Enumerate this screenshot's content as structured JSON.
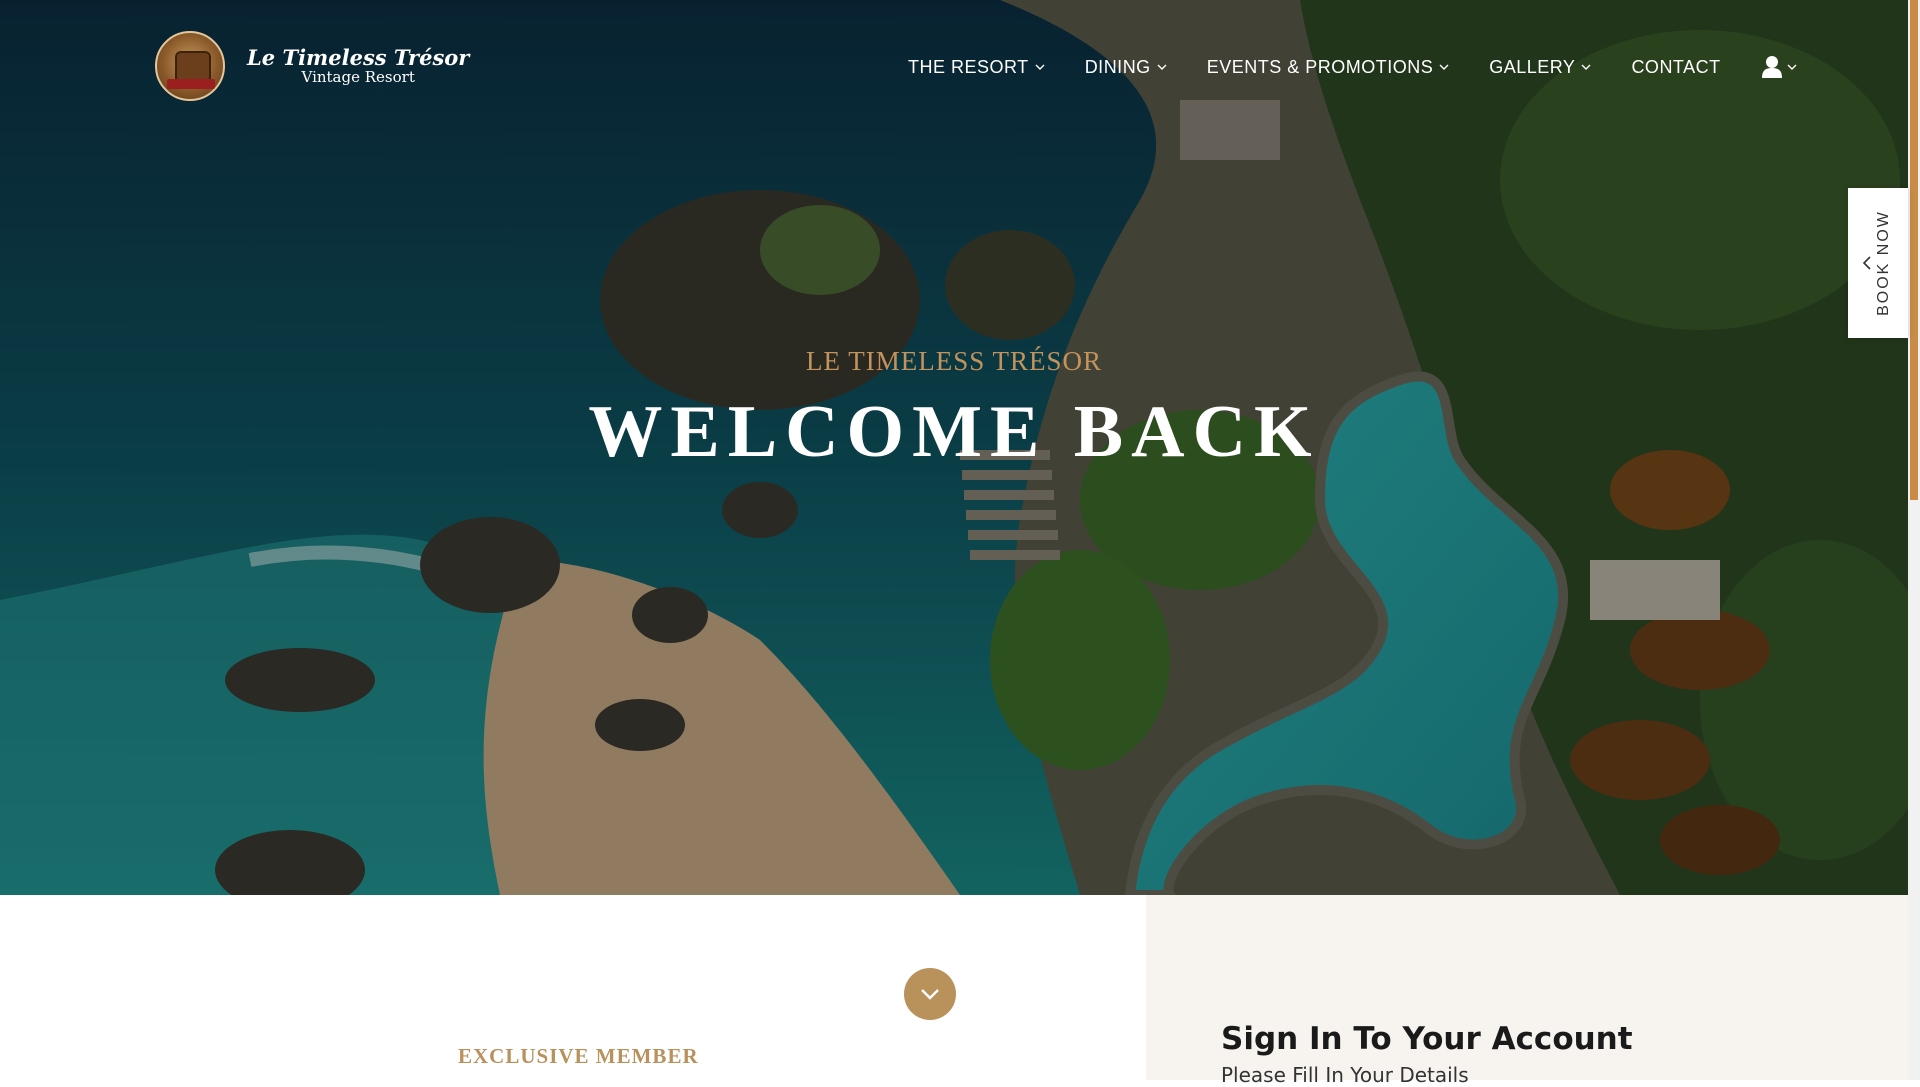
{
  "header": {
    "logo_name": "Le Timeless Trésor",
    "logo_subtitle": "Vintage Resort",
    "nav": [
      {
        "label": "THE RESORT",
        "dropdown": true
      },
      {
        "label": "DINING",
        "dropdown": true
      },
      {
        "label": "EVENTS & PROMOTIONS",
        "dropdown": true
      },
      {
        "label": "GALLERY",
        "dropdown": true
      },
      {
        "label": "CONTACT",
        "dropdown": false
      }
    ],
    "user_icon": "user-icon"
  },
  "book_tab": {
    "label": "BOOK NOW",
    "icon": "chevron-left-icon"
  },
  "hero": {
    "kicker": "LE TIMELESS TRÉSOR",
    "headline": "WELCOME BACK",
    "background": "aerial ocean cliff resort pool"
  },
  "member": {
    "kicker": "EXCLUSIVE MEMBER"
  },
  "signin": {
    "title": "Sign In To Your Account",
    "subtitle": "Please Fill In Your Details"
  },
  "colors": {
    "accent": "#b8915b",
    "kicker": "#c2935c",
    "panel": "#f7f4f0",
    "scrollbar_thumb": "#c98b45"
  }
}
